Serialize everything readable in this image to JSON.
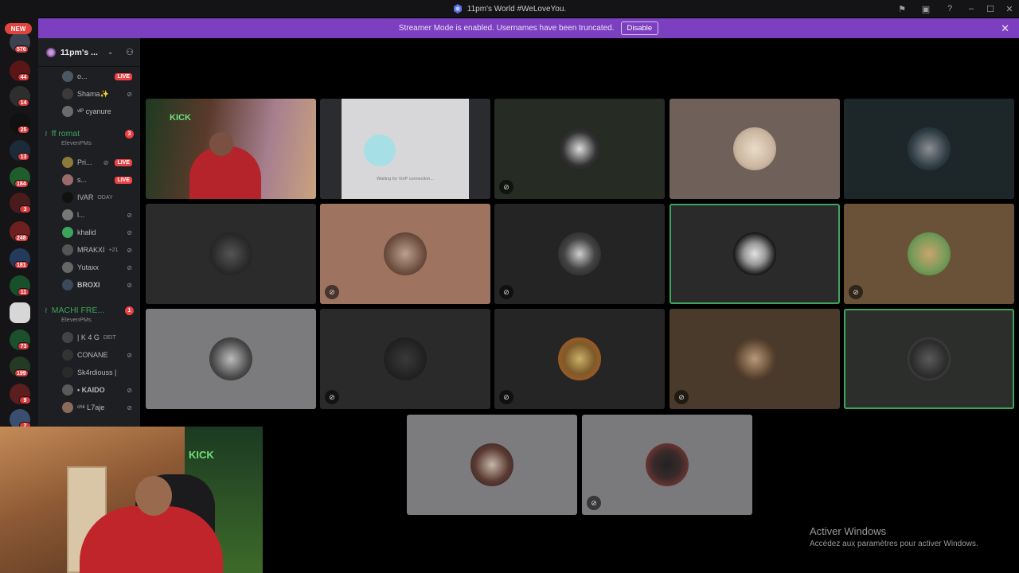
{
  "window": {
    "title": "11pm's World #WeLoveYou."
  },
  "banner": {
    "text": "Streamer Mode is enabled. Usernames have been truncated.",
    "disable_label": "Disable"
  },
  "rail": {
    "new_label": "NEW",
    "badges": [
      "576",
      "44",
      "14",
      "25",
      "13",
      "184",
      "3",
      "248",
      "181",
      "11",
      "73",
      "199",
      "9",
      "2"
    ]
  },
  "server": {
    "name": "11pm's ..."
  },
  "channels": [
    {
      "name": "ff romat",
      "count": "3",
      "sub": "ElevenPMs"
    },
    {
      "name": "MACHI FRE...",
      "count": "1",
      "sub": "ElevenPMs"
    }
  ],
  "members": [
    {
      "name": "o...",
      "tag": "LIVE",
      "extra": ""
    },
    {
      "name": "Shama✨",
      "tag": "",
      "extra": ""
    },
    {
      "name": "ᵛᴵᴾ cyanure",
      "tag": "",
      "extra": ""
    },
    {
      "name": "Pri...",
      "tag": "LIVE",
      "extra": ""
    },
    {
      "name": "s...",
      "tag": "LIVE",
      "extra": ""
    },
    {
      "name": "IVAR",
      "tag": "",
      "extra": "ODAY"
    },
    {
      "name": "l...",
      "tag": "",
      "extra": ""
    },
    {
      "name": "khalid",
      "tag": "",
      "extra": ""
    },
    {
      "name": "MRAKXI",
      "tag": "",
      "extra": "+21"
    },
    {
      "name": "Yutaxx",
      "tag": "",
      "extra": ""
    },
    {
      "name": "BROXI",
      "tag": "",
      "extra": ""
    },
    {
      "name": "| K 4 G",
      "tag": "",
      "extra": "DEIT"
    },
    {
      "name": "CONANE",
      "tag": "",
      "extra": ""
    },
    {
      "name": "Sk4rdiouss |",
      "tag": "",
      "extra": ""
    },
    {
      "name": "• KAIDO",
      "tag": "",
      "extra": ""
    },
    {
      "name": "ᶜʰᵏ L7aje",
      "tag": "",
      "extra": ""
    }
  ],
  "stream_tiles": {
    "kick_label": "KICK",
    "connecting_text": "Waiting for VoIP connection..."
  },
  "watermark": {
    "title": "Activer Windows",
    "subtitle": "Accédez aux paramètres pour activer Windows."
  },
  "colors": {
    "banner": "#7c3fc0",
    "speaking": "#3fa45e",
    "live": "#ed4245",
    "voice_green": "#3ba55d"
  }
}
